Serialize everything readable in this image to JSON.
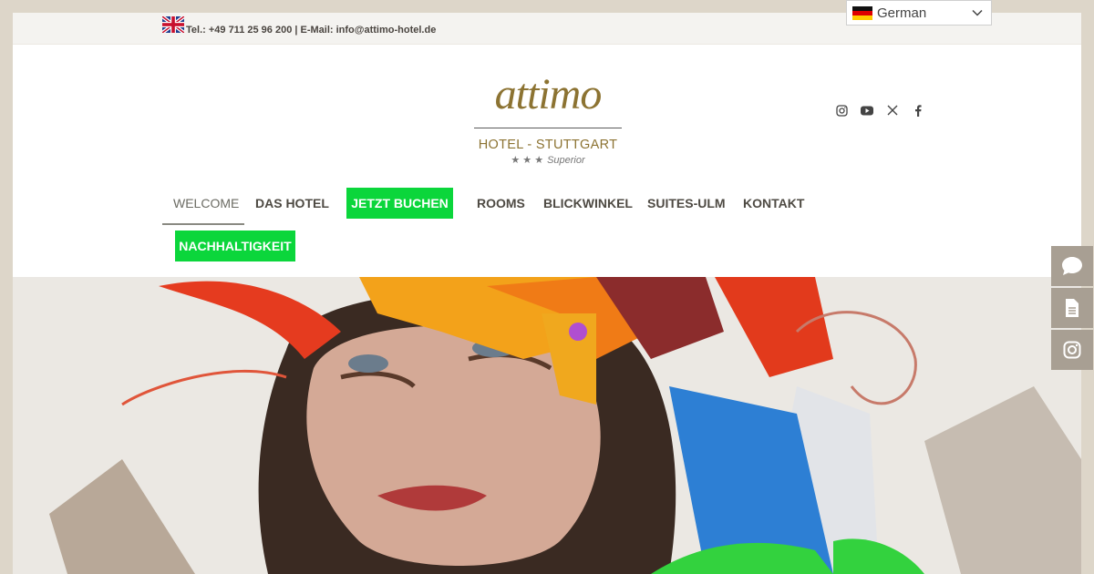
{
  "topbar": {
    "contact": "Tel.: +49 711 25 96 200 | E-Mail: info@attimo-hotel.de",
    "english_flag_icon": "uk-flag-icon"
  },
  "language": {
    "selected": "German",
    "flag_icon": "german-flag-icon"
  },
  "logo": {
    "wordmark": "attimo",
    "subtitle": "HOTEL - STUTTGART",
    "stars": "★ ★ ★",
    "rating": "Superior"
  },
  "social": [
    "instagram-icon",
    "youtube-icon",
    "x-icon",
    "facebook-icon"
  ],
  "nav": {
    "welcome": "WELCOME",
    "das_hotel": "DAS HOTEL",
    "jetzt_buchen": "JETZT BUCHEN",
    "rooms": "ROOMS",
    "blickwinkel": "BLICKWINKEL",
    "suites_ulm": "SUITES-ULM",
    "kontakt": "KONTAKT",
    "nachhaltigkeit": "NACHHALTIGKEIT"
  },
  "side_tabs": [
    "chat-icon",
    "document-icon",
    "instagram-icon"
  ],
  "colors": {
    "accent_green": "#0bd63b",
    "brand_gold": "#8c7332",
    "background": "#ddd6c9",
    "side_tab": "#a89f93"
  }
}
